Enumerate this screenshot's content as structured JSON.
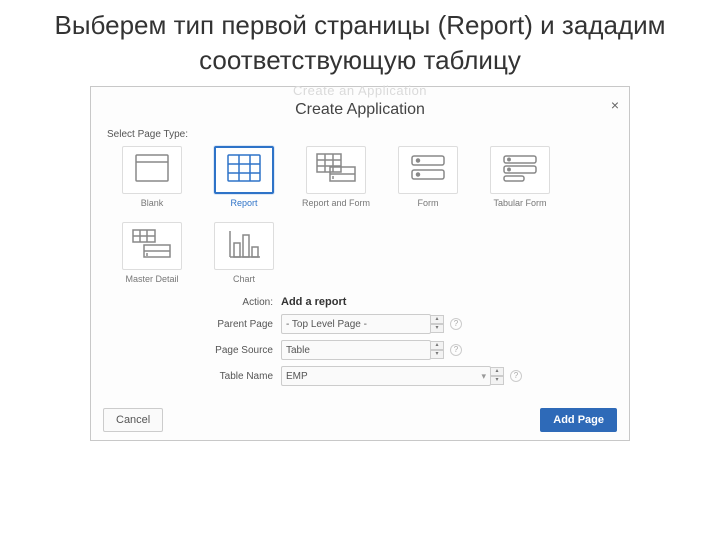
{
  "slide": {
    "title": "Выберем тип первой страницы (Report) и зададим соответствующую таблицу"
  },
  "dialog": {
    "faint": "Create an Application",
    "title": "Create Application",
    "close": "×",
    "section_label": "Select Page Type:",
    "tiles": [
      {
        "label": "Blank"
      },
      {
        "label": "Report"
      },
      {
        "label": "Report and Form"
      },
      {
        "label": "Form"
      },
      {
        "label": "Tabular Form"
      },
      {
        "label": "Master Detail"
      },
      {
        "label": "Chart"
      }
    ],
    "form": {
      "action_label": "Action:",
      "action_value": "Add a report",
      "parent_label": "Parent Page",
      "parent_value": "- Top Level Page -",
      "source_label": "Page Source",
      "source_value": "Table",
      "table_label": "Table Name",
      "table_value": "EMP"
    },
    "buttons": {
      "cancel": "Cancel",
      "add": "Add Page"
    }
  }
}
